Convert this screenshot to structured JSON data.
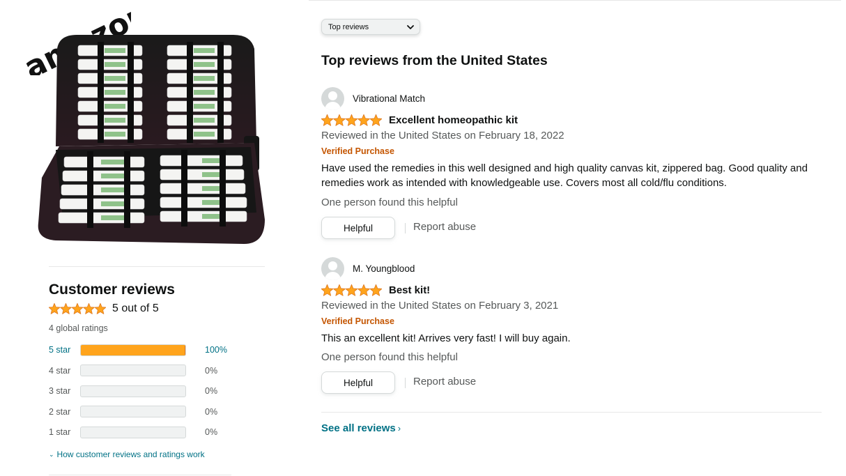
{
  "brand": {
    "logo_text": "amazon"
  },
  "sort": {
    "selected": "Top reviews"
  },
  "section_title": "Top reviews from the United States",
  "summary": {
    "title": "Customer reviews",
    "rating": 5,
    "rating_text": "5 out of 5",
    "global_ratings": "4 global ratings",
    "histogram": [
      {
        "label": "5 star",
        "pct": "100%",
        "fraction": 1.0
      },
      {
        "label": "4 star",
        "pct": "0%",
        "fraction": 0
      },
      {
        "label": "3 star",
        "pct": "0%",
        "fraction": 0
      },
      {
        "label": "2 star",
        "pct": "0%",
        "fraction": 0
      },
      {
        "label": "1 star",
        "pct": "0%",
        "fraction": 0
      }
    ],
    "how_link": "How customer reviews and ratings work"
  },
  "reviews": [
    {
      "reviewer": "Vibrational Match",
      "rating": 5,
      "title": "Excellent homeopathic kit",
      "date": "Reviewed in the United States on February 18, 2022",
      "verified": "Verified Purchase",
      "body": "Have used the remedies in this well designed and high quality canvas kit, zippered bag. Good quality and remedies work as intended with knowledgeable use. Covers most all cold/flu conditions.",
      "helpful_count": "One person found this helpful",
      "helpful_label": "Helpful",
      "report_label": "Report abuse"
    },
    {
      "reviewer": "M. Youngblood",
      "rating": 5,
      "title": "Best kit!",
      "date": "Reviewed in the United States on February 3, 2021",
      "verified": "Verified Purchase",
      "body": "This an excellent kit! Arrives very fast! I will buy again.",
      "helpful_count": "One person found this helpful",
      "helpful_label": "Helpful",
      "report_label": "Report abuse"
    }
  ],
  "see_all": "See all reviews",
  "colors": {
    "star": "#ffa41c",
    "link": "#007185",
    "verified": "#c45500"
  },
  "icons": {
    "star": "star-icon",
    "avatar": "user-avatar-icon",
    "sort_chevron": "chevron-down-icon"
  }
}
